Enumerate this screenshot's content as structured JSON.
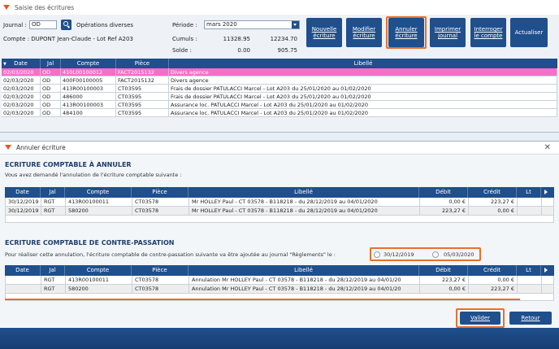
{
  "window": {
    "title": "Saisie des écritures"
  },
  "form": {
    "journal_label": "Journal :",
    "journal_value": "OD",
    "journal_desc": "Opérations diverses",
    "compte_label": "Compte : DUPONT Jean-Claude - Lot Ref A203",
    "periode_label": "Période :",
    "periode_value": "mars 2020",
    "cumuls_label": "Cumuls :",
    "cumuls_debit": "11328.95",
    "cumuls_credit": "12234.70",
    "solde_label": "Solde :",
    "solde_debit": "0.00",
    "solde_credit": "905.75"
  },
  "toolbar": {
    "nouvelle": "Nouvelle\nécriture",
    "modifier": "Modifier\nécriture",
    "annuler": "Annuler\nécriture",
    "imprimer": "Imprimer\njournal",
    "interroger": "Interroger\nle compte",
    "actualiser": "Actualiser"
  },
  "main_grid": {
    "headers": [
      "Date",
      "Jal",
      "Compte",
      "Pièce",
      "Libellé"
    ],
    "rows": [
      [
        "02/03/2020",
        "OD",
        "410L00100012",
        "FACT2015132",
        "Divers agence"
      ],
      [
        "02/03/2020",
        "OD",
        "400F00100005",
        "FACT2015132",
        "Divers agence"
      ],
      [
        "02/03/2020",
        "OD",
        "413R00100003",
        "CT03595",
        "Frais de dossier PATULACCI Marcel - Lot A203  du 25/01/2020 au 01/02/2020"
      ],
      [
        "02/03/2020",
        "OD",
        "486000",
        "CT03595",
        "Frais de dossier PATULACCI Marcel - Lot A203  du 25/01/2020 au 01/02/2020"
      ],
      [
        "02/03/2020",
        "OD",
        "413R00100003",
        "CT03595",
        "Assurance loc. PATULACCI Marcel - Lot A203  du 25/01/2020 au 01/02/2020"
      ],
      [
        "02/03/2020",
        "OD",
        "484100",
        "CT03595",
        "Assurance loc. PATULACCI Marcel - Lot A203  du 25/01/2020 au 01/02/2020"
      ]
    ]
  },
  "dialog": {
    "title": "Annuler écriture",
    "section1_title": "ECRITURE COMPTABLE À ANNULER",
    "section1_sub": "Vous avez demandé l'annulation de l'écriture comptable suivante :",
    "headers": [
      "Date",
      "Jal",
      "Compte",
      "Pièce",
      "Libellé",
      "Débit",
      "Crédit",
      "Lt"
    ],
    "rows1": [
      [
        "30/12/2019",
        "RGT",
        "413R00100011",
        "CT03578",
        "Mr HOLLEY Paul - CT 03578 - B118218 -  du 28/12/2019 au 04/01/2020",
        "0,00 €",
        "223,27 €",
        ""
      ],
      [
        "30/12/2019",
        "RGT",
        "580200",
        "CT03578",
        "Mr HOLLEY Paul - CT 03578 - B118218 -  du 28/12/2019 au 04/01/2020",
        "223,27 €",
        "0,00 €",
        ""
      ]
    ],
    "section2_title": "ECRITURE COMPTABLE DE CONTRE-PASSATION",
    "section2_sub": "Pour réaliser cette annulation, l'écriture comptable de contre-passation suivante va être ajoutée au journal \"Règlements\" le :",
    "radio1": "30/12/2019",
    "radio2": "05/03/2020",
    "rows2": [
      [
        "",
        "RGT",
        "413R00100011",
        "CT03578",
        "Annulation Mr HOLLEY Paul - CT 03578 - B118218 -  du 28/12/2019 au 04/01/20",
        "223,27 €",
        "0,00 €",
        ""
      ],
      [
        "",
        "RGT",
        "580200",
        "CT03578",
        "Annulation Mr HOLLEY Paul - CT 03578 - B118218 -  du 28/12/2019 au 04/01/20",
        "0,00 €",
        "223,27 €",
        ""
      ]
    ],
    "valider": "Valider",
    "retour": "Retour"
  },
  "colors": {
    "accent": "#1f4f8c",
    "highlight": "#e8702a",
    "selected_row": "#f56fc9"
  }
}
